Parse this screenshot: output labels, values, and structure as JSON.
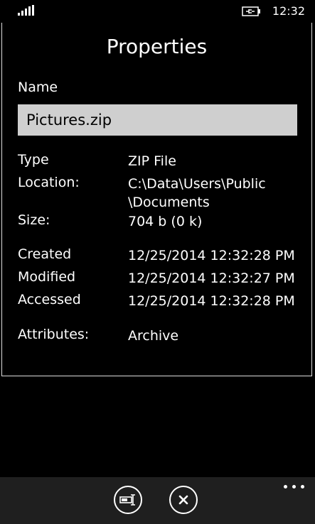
{
  "status": {
    "time": "12:32"
  },
  "dialog": {
    "title": "Properties",
    "name_label": "Name",
    "name_value": "Pictures.zip",
    "rows": [
      {
        "label": "Type",
        "value": "ZIP File"
      },
      {
        "label": "Location:",
        "value": "C:\\Data\\Users\\Public",
        "value2": "\\Documents"
      },
      {
        "label": "Size:",
        "value": "704 b (0 k)"
      },
      {
        "label": "Created",
        "value": "12/25/2014 12:32:28 PM"
      },
      {
        "label": "Modified",
        "value": "12/25/2014 12:32:27 PM"
      },
      {
        "label": "Accessed",
        "value": "12/25/2014 12:32:28 PM"
      },
      {
        "label": "Attributes:",
        "value": "Archive"
      }
    ]
  },
  "app_bar": {
    "icons": [
      "rename-icon",
      "cancel-icon",
      "more-icon"
    ]
  }
}
